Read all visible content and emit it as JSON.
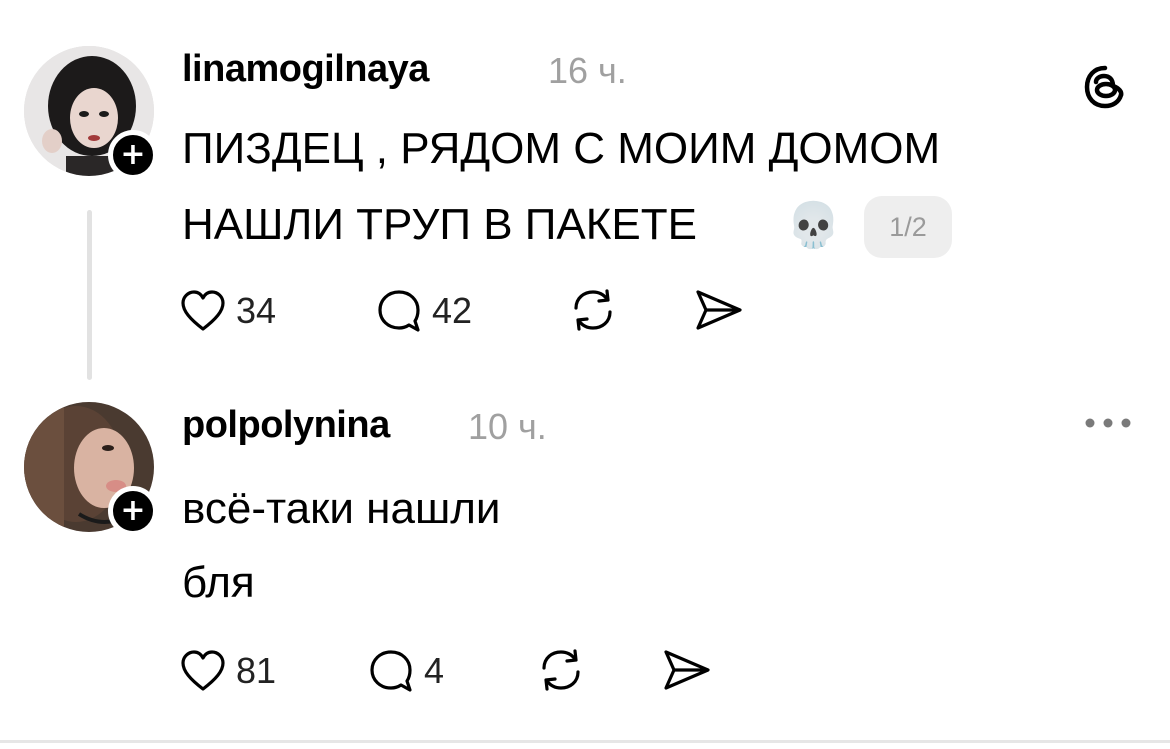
{
  "posts": [
    {
      "username": "linamogilnaya",
      "time": "16 ч.",
      "text_line1": "ПИЗДЕЦ , РЯДОМ С МОИМ ДОМОМ",
      "text_line2": "НАШЛИ ТРУП В ПАКЕТЕ",
      "emoji": "💀",
      "thread_counter": "1/2",
      "likes": "34",
      "replies": "42",
      "follow_badge": "+"
    },
    {
      "username": "polpolynina",
      "time": "10 ч.",
      "text_line1": "всё-таки нашли",
      "text_line2": "бля",
      "likes": "81",
      "replies": "4",
      "follow_badge": "+"
    }
  ],
  "menu_icon": "more-horizontal-icon",
  "app_icon": "threads-logo-icon",
  "colors": {
    "text": "#000000",
    "meta": "#a0a0a0",
    "thread_line": "#e2e2e2",
    "badge_bg": "#eeeeee"
  }
}
